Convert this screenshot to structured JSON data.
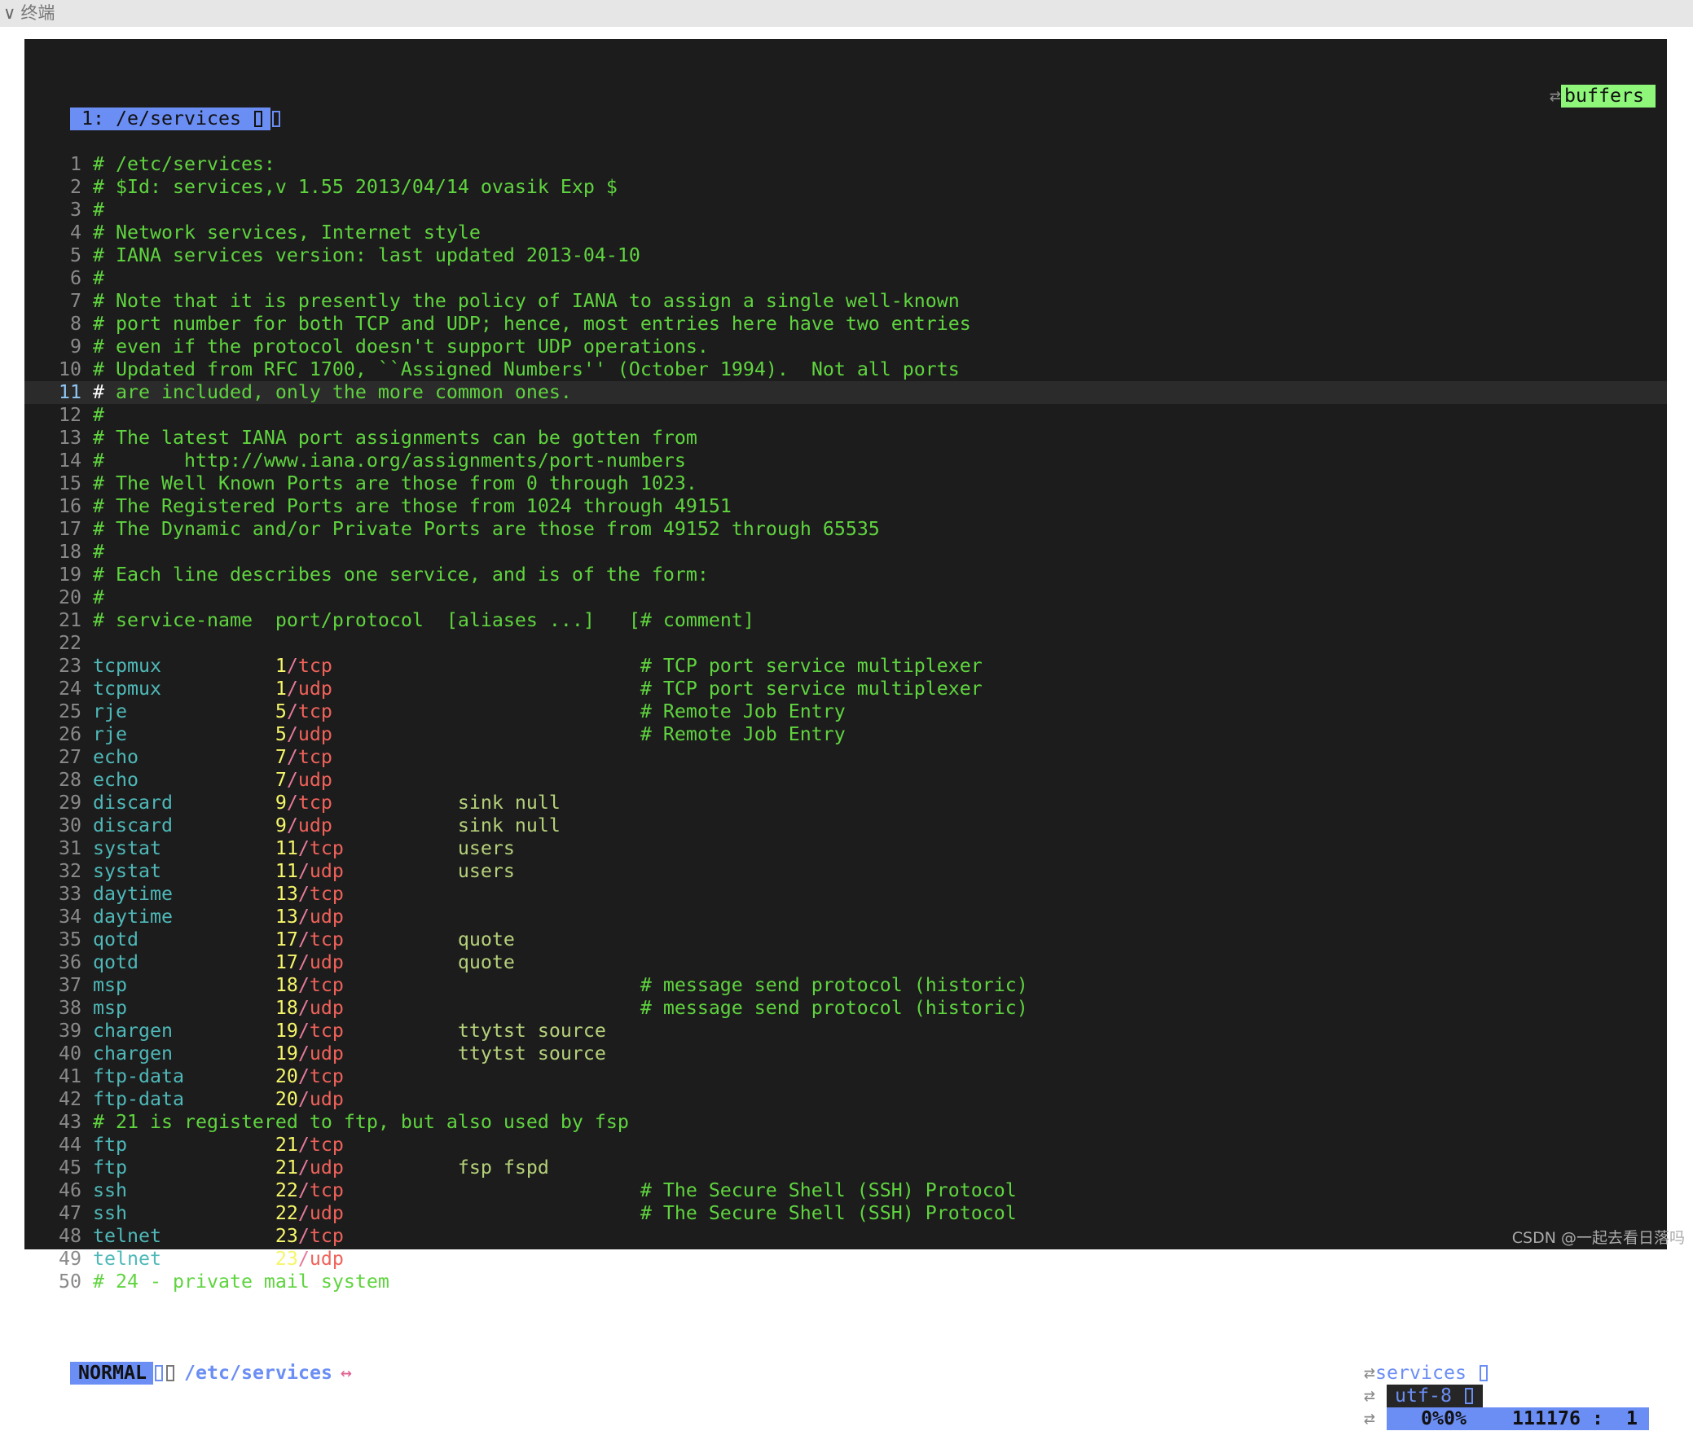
{
  "window": {
    "title": "终端",
    "collapse_icon": "chevron-down-icon"
  },
  "tabline": {
    "active_tab": "1: /e/services",
    "buffers_label": "buffers",
    "buffers_icon": "swap-arrows-icon"
  },
  "colors": {
    "background": "#1c1c1c",
    "accent_blue": "#6b8ef5",
    "buffers_green": "#8ef77a",
    "comment": "#5fd43f",
    "service_name": "#4fb8b8",
    "port": "#f5f56a",
    "protocol": "#f0625a",
    "aliases": "#b5d17a"
  },
  "editor": {
    "current_line": 11,
    "lines": [
      {
        "n": "1",
        "comment": "# /etc/services:"
      },
      {
        "n": "2",
        "comment": "# $Id: services,v 1.55 2013/04/14 ovasik Exp $"
      },
      {
        "n": "3",
        "comment": "#"
      },
      {
        "n": "4",
        "comment": "# Network services, Internet style"
      },
      {
        "n": "5",
        "comment": "# IANA services version: last updated 2013-04-10"
      },
      {
        "n": "6",
        "comment": "#"
      },
      {
        "n": "7",
        "comment": "# Note that it is presently the policy of IANA to assign a single well-known"
      },
      {
        "n": "8",
        "comment": "# port number for both TCP and UDP; hence, most entries here have two entries"
      },
      {
        "n": "9",
        "comment": "# even if the protocol doesn't support UDP operations."
      },
      {
        "n": "10",
        "comment": "# Updated from RFC 1700, ``Assigned Numbers'' (October 1994).  Not all ports"
      },
      {
        "n": "11",
        "comment": "# are included, only the more common ones."
      },
      {
        "n": "12",
        "comment": "#"
      },
      {
        "n": "13",
        "comment": "# The latest IANA port assignments can be gotten from"
      },
      {
        "n": "14",
        "comment": "#       http://www.iana.org/assignments/port-numbers"
      },
      {
        "n": "15",
        "comment": "# The Well Known Ports are those from 0 through 1023."
      },
      {
        "n": "16",
        "comment": "# The Registered Ports are those from 1024 through 49151"
      },
      {
        "n": "17",
        "comment": "# The Dynamic and/or Private Ports are those from 49152 through 65535"
      },
      {
        "n": "18",
        "comment": "#"
      },
      {
        "n": "19",
        "comment": "# Each line describes one service, and is of the form:"
      },
      {
        "n": "20",
        "comment": "#"
      },
      {
        "n": "21",
        "comment": "# service-name  port/protocol  [aliases ...]   [# comment]"
      },
      {
        "n": "22",
        "comment": ""
      },
      {
        "n": "23",
        "name": "tcpmux",
        "port": "1",
        "proto": "tcp",
        "aliases": "",
        "note": "# TCP port service multiplexer"
      },
      {
        "n": "24",
        "name": "tcpmux",
        "port": "1",
        "proto": "udp",
        "aliases": "",
        "note": "# TCP port service multiplexer"
      },
      {
        "n": "25",
        "name": "rje",
        "port": "5",
        "proto": "tcp",
        "aliases": "",
        "note": "# Remote Job Entry"
      },
      {
        "n": "26",
        "name": "rje",
        "port": "5",
        "proto": "udp",
        "aliases": "",
        "note": "# Remote Job Entry"
      },
      {
        "n": "27",
        "name": "echo",
        "port": "7",
        "proto": "tcp",
        "aliases": "",
        "note": ""
      },
      {
        "n": "28",
        "name": "echo",
        "port": "7",
        "proto": "udp",
        "aliases": "",
        "note": ""
      },
      {
        "n": "29",
        "name": "discard",
        "port": "9",
        "proto": "tcp",
        "aliases": "sink null",
        "note": ""
      },
      {
        "n": "30",
        "name": "discard",
        "port": "9",
        "proto": "udp",
        "aliases": "sink null",
        "note": ""
      },
      {
        "n": "31",
        "name": "systat",
        "port": "11",
        "proto": "tcp",
        "aliases": "users",
        "note": ""
      },
      {
        "n": "32",
        "name": "systat",
        "port": "11",
        "proto": "udp",
        "aliases": "users",
        "note": ""
      },
      {
        "n": "33",
        "name": "daytime",
        "port": "13",
        "proto": "tcp",
        "aliases": "",
        "note": ""
      },
      {
        "n": "34",
        "name": "daytime",
        "port": "13",
        "proto": "udp",
        "aliases": "",
        "note": ""
      },
      {
        "n": "35",
        "name": "qotd",
        "port": "17",
        "proto": "tcp",
        "aliases": "quote",
        "note": ""
      },
      {
        "n": "36",
        "name": "qotd",
        "port": "17",
        "proto": "udp",
        "aliases": "quote",
        "note": ""
      },
      {
        "n": "37",
        "name": "msp",
        "port": "18",
        "proto": "tcp",
        "aliases": "",
        "note": "# message send protocol (historic)"
      },
      {
        "n": "38",
        "name": "msp",
        "port": "18",
        "proto": "udp",
        "aliases": "",
        "note": "# message send protocol (historic)"
      },
      {
        "n": "39",
        "name": "chargen",
        "port": "19",
        "proto": "tcp",
        "aliases": "ttytst source",
        "note": ""
      },
      {
        "n": "40",
        "name": "chargen",
        "port": "19",
        "proto": "udp",
        "aliases": "ttytst source",
        "note": ""
      },
      {
        "n": "41",
        "name": "ftp-data",
        "port": "20",
        "proto": "tcp",
        "aliases": "",
        "note": ""
      },
      {
        "n": "42",
        "name": "ftp-data",
        "port": "20",
        "proto": "udp",
        "aliases": "",
        "note": ""
      },
      {
        "n": "43",
        "comment": "# 21 is registered to ftp, but also used by fsp"
      },
      {
        "n": "44",
        "name": "ftp",
        "port": "21",
        "proto": "tcp",
        "aliases": "",
        "note": ""
      },
      {
        "n": "45",
        "name": "ftp",
        "port": "21",
        "proto": "udp",
        "aliases": "fsp fspd",
        "note": ""
      },
      {
        "n": "46",
        "name": "ssh",
        "port": "22",
        "proto": "tcp",
        "aliases": "",
        "note": "# The Secure Shell (SSH) Protocol"
      },
      {
        "n": "47",
        "name": "ssh",
        "port": "22",
        "proto": "udp",
        "aliases": "",
        "note": "# The Secure Shell (SSH) Protocol"
      },
      {
        "n": "48",
        "name": "telnet",
        "port": "23",
        "proto": "tcp",
        "aliases": "",
        "note": ""
      },
      {
        "n": "49",
        "name": "telnet",
        "port": "23",
        "proto": "udp",
        "aliases": "",
        "note": ""
      },
      {
        "n": "50",
        "comment": "# 24 - private mail system"
      }
    ]
  },
  "statusline": {
    "mode": "NORMAL",
    "file": "/etc/services",
    "modified_marker": "↔",
    "filetype": "services",
    "encoding": "utf-8",
    "percent": "0%0%",
    "position": "111176 :  1"
  },
  "watermark": "CSDN @一起去看日落吗"
}
